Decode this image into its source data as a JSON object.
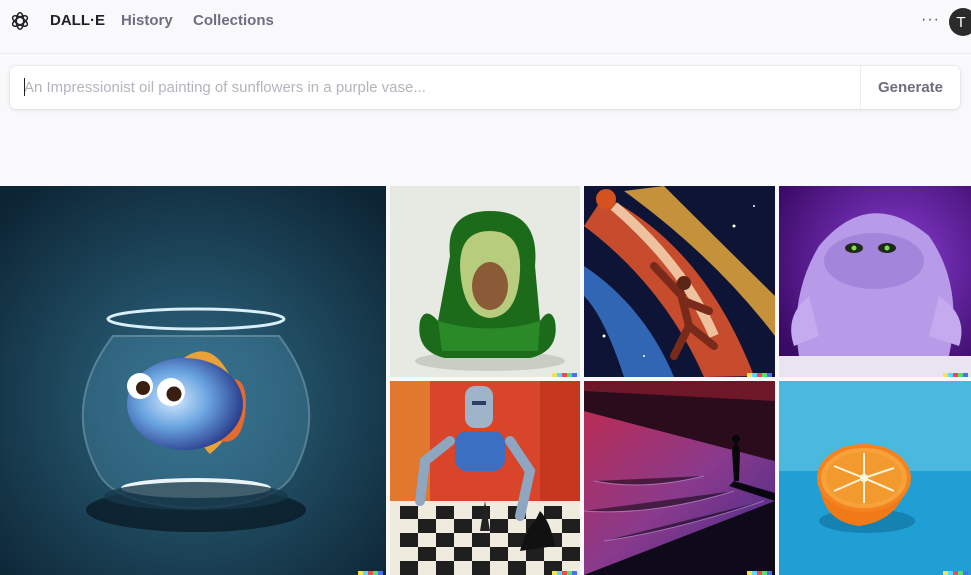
{
  "app": {
    "brand": "DALL·E",
    "nav": {
      "history": "History",
      "collections": "Collections"
    },
    "more_label": "···",
    "avatar_initial": "T"
  },
  "prompt": {
    "placeholder": "An Impressionist oil painting of sunflowers in a purple vase...",
    "value": "",
    "generate_label": "Generate"
  },
  "gallery": {
    "images": [
      {
        "subject": "fish in glass bowl"
      },
      {
        "subject": "avocado armchair"
      },
      {
        "subject": "basketball player in space"
      },
      {
        "subject": "purple fluffy monster"
      },
      {
        "subject": "robot playing chess"
      },
      {
        "subject": "figure in sand dune corridor"
      },
      {
        "subject": "orange half on blue table"
      }
    ],
    "signature_colors": [
      "#f7e34b",
      "#5ad6ff",
      "#e94c4c",
      "#54e06a",
      "#4c6ff0"
    ]
  }
}
